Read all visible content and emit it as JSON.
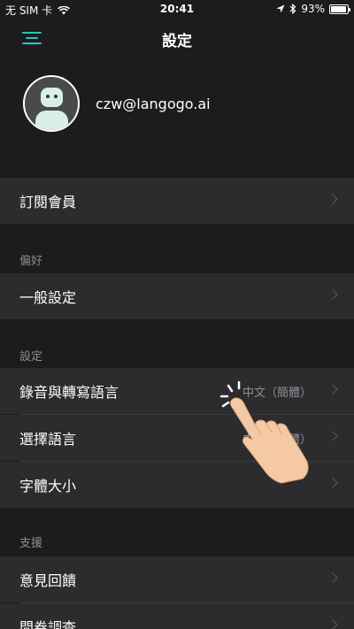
{
  "status_bar": {
    "carrier": "无 SIM 卡",
    "time": "20:41",
    "battery": "93%",
    "battery_level": 0.93
  },
  "nav": {
    "title": "設定"
  },
  "profile": {
    "email": "czw@langogo.ai"
  },
  "rows": {
    "subscription": "訂閱會員",
    "general": "一般設定",
    "record_language": "錄音與轉寫語言",
    "record_language_value": "中文（簡體）",
    "choose_language": "選擇語言",
    "choose_language_value": "中文（簡體）",
    "font_size": "字體大小",
    "feedback": "意見回饋",
    "survey": "問卷調查"
  },
  "sections": {
    "preferences": "偏好",
    "settings": "設定",
    "support": "支援"
  },
  "colors": {
    "accent": "#25c7b5",
    "background": "#1c1c1e",
    "row": "#2c2c2e",
    "secondary_text": "#8e8e93"
  }
}
